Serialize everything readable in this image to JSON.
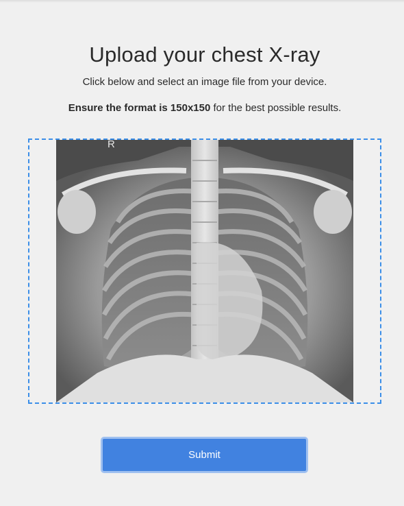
{
  "upload": {
    "title": "Upload your chest X-ray",
    "instruction": "Click below and select an image file from your device.",
    "format_note_bold": "Ensure the format is 150x150",
    "format_note_rest": " for the best possible results."
  },
  "image": {
    "marker": "R"
  },
  "submit": {
    "label": "Submit"
  },
  "colors": {
    "accent": "#4182e0",
    "dropzone_border": "#3b8ee8",
    "background": "#f0f0f0"
  }
}
